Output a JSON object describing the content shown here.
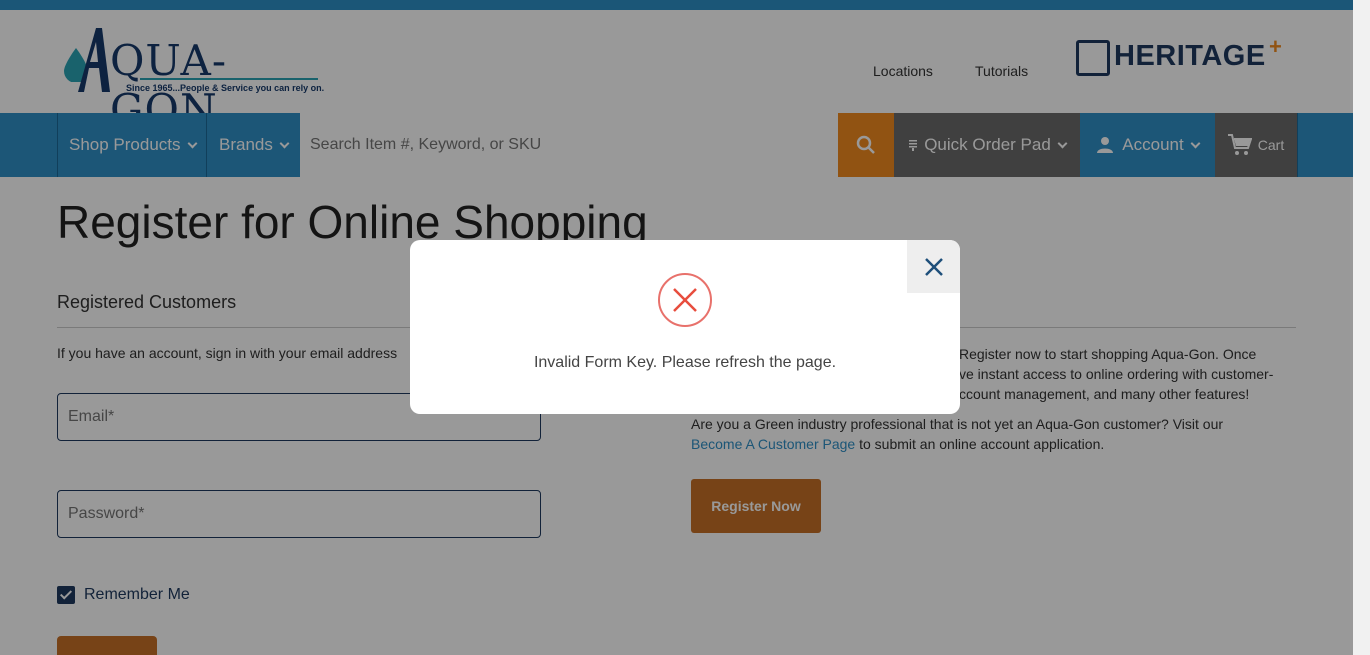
{
  "header": {
    "logo_text": "QUA-GON",
    "logo_tagline": "Since 1965...People & Service you can rely on.",
    "links": [
      "Locations",
      "Tutorials"
    ],
    "partner_logo": "HERITAGE",
    "partner_plus": "+"
  },
  "nav": {
    "shop_products": "Shop Products",
    "brands": "Brands",
    "search_placeholder": "Search Item #, Keyword, or SKU",
    "quick_order_pad": "Quick Order Pad",
    "account": "Account",
    "cart": "Cart"
  },
  "main": {
    "title": "Register for Online Shopping",
    "registered_title": "Registered Customers",
    "registered_intro": "If you have an account, sign in with your email address",
    "email_placeholder": "Email*",
    "password_placeholder": "Password*",
    "remember_me": "Remember Me",
    "new_text_1": "Register now to start shopping Aqua-Gon. Once",
    "new_text_2": "ve instant access to online ordering with customer-",
    "new_text_3": "ccount management, and many other features!",
    "green_text": "Are you a Green industry professional that is not yet an Aqua-Gon customer? Visit our",
    "become_link": "Become A Customer Page",
    "green_text_end": " to submit an online account application.",
    "register_button": "Register Now"
  },
  "modal": {
    "message": "Invalid Form Key. Please refresh the page."
  },
  "colors": {
    "brand_blue": "#2f8fc6",
    "accent_orange": "#f28a1e",
    "error_red": "#e84c3d"
  }
}
